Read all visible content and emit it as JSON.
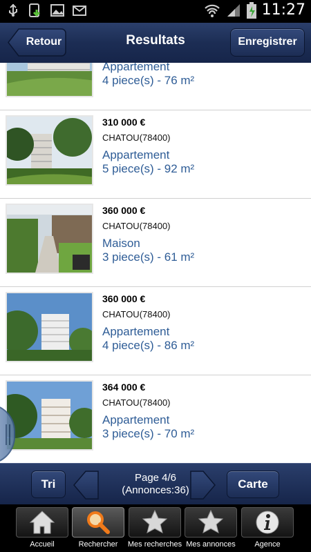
{
  "status_bar": {
    "time": "11:27",
    "icons": [
      "usb-icon",
      "download-icon",
      "image-icon",
      "mail-icon",
      "wifi-icon",
      "signal-icon",
      "battery-icon"
    ]
  },
  "header": {
    "title": "Resultats",
    "back_label": "Retour",
    "save_label": "Enregistrer"
  },
  "listings": [
    {
      "price": "",
      "city": "",
      "type": "Appartement",
      "desc": "4 piece(s) - 76 m²"
    },
    {
      "price": "310 000 €",
      "city": "CHATOU(78400)",
      "type": "Appartement",
      "desc": "5 piece(s) - 92 m²"
    },
    {
      "price": "360 000 €",
      "city": "CHATOU(78400)",
      "type": "Maison",
      "desc": "3 piece(s) - 61 m²"
    },
    {
      "price": "360 000 €",
      "city": "CHATOU(78400)",
      "type": "Appartement",
      "desc": "4 piece(s) - 86 m²"
    },
    {
      "price": "364 000 €",
      "city": "CHATOU(78400)",
      "type": "Appartement",
      "desc": "3 piece(s) - 70 m²"
    }
  ],
  "pager": {
    "sort_label": "Tri",
    "page_text": "Page 4/6",
    "count_text": "(Annonces:36)",
    "map_label": "Carte"
  },
  "tabs": [
    {
      "label": "Accueil",
      "icon": "home-icon"
    },
    {
      "label": "Rechercher",
      "icon": "search-icon"
    },
    {
      "label": "Mes recherches",
      "icon": "star-icon"
    },
    {
      "label": "Mes annonces",
      "icon": "star-icon"
    },
    {
      "label": "Agence",
      "icon": "info-icon"
    }
  ],
  "colors": {
    "header": "#1c2d54",
    "link_text": "#2e5c96",
    "tab_bar": "#000000"
  }
}
